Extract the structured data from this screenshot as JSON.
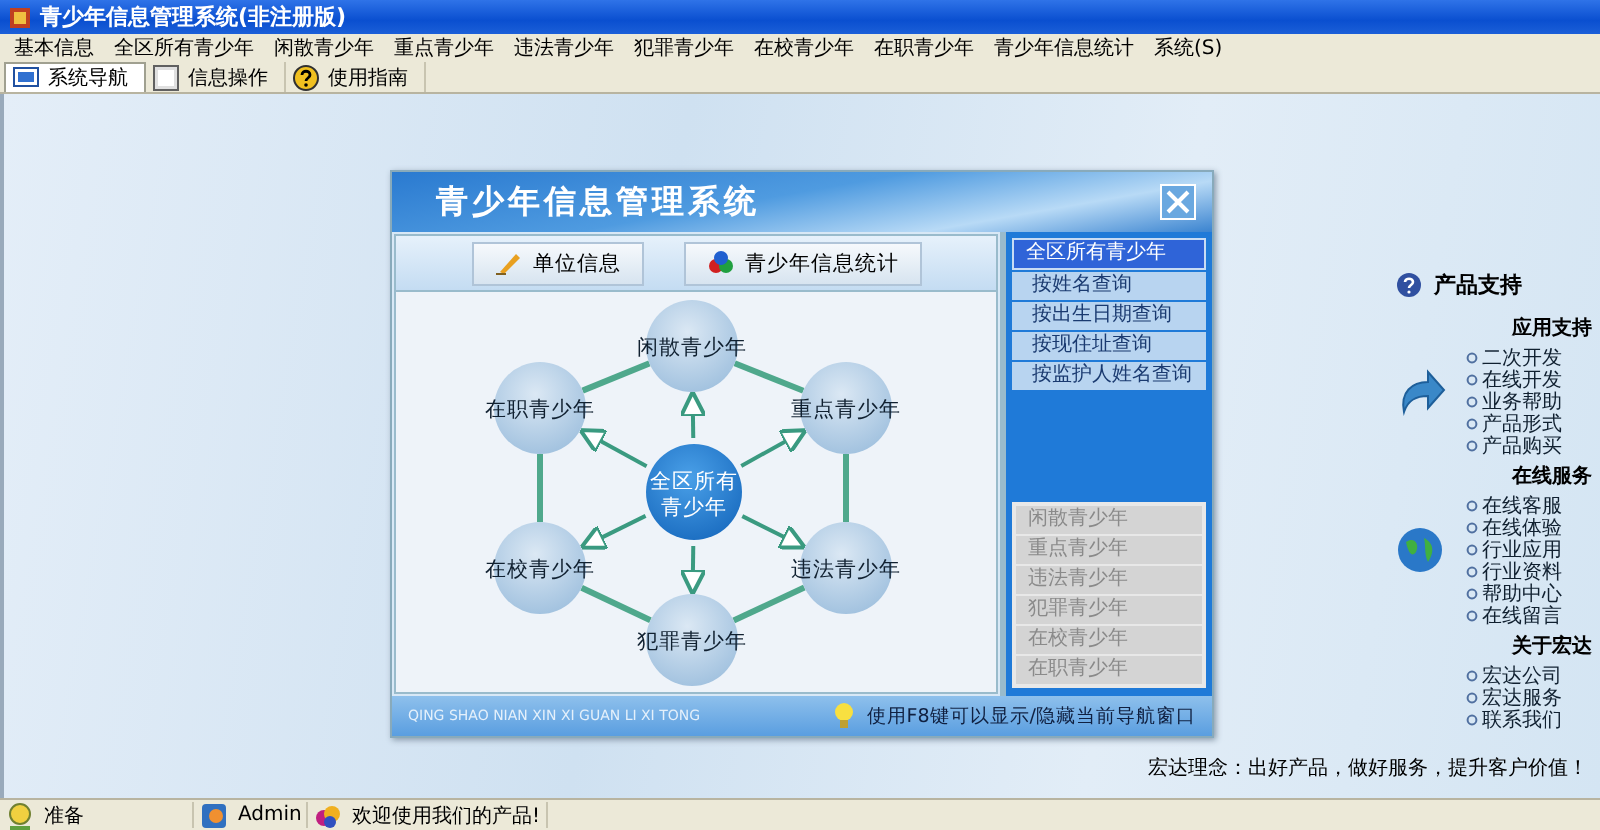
{
  "window": {
    "title": "青少年信息管理系统(非注册版)"
  },
  "menu_bar": [
    "基本信息",
    "全区所有青少年",
    "闲散青少年",
    "重点青少年",
    "违法青少年",
    "犯罪青少年",
    "在校青少年",
    "在职青少年",
    "青少年信息统计",
    "系统(S)"
  ],
  "toolbar_tabs": [
    {
      "label": "系统导航",
      "selected": true
    },
    {
      "label": "信息操作",
      "selected": false
    },
    {
      "label": "使用指南",
      "selected": false
    }
  ],
  "dialog": {
    "title": "青少年信息管理系统",
    "buttons": [
      "单位信息",
      "青少年信息统计"
    ],
    "diagram": {
      "center": "全区所有青少年",
      "nodes": [
        "闲散青少年",
        "重点青少年",
        "违法青少年",
        "犯罪青少年",
        "在校青少年",
        "在职青少年"
      ]
    },
    "query_list": [
      {
        "label": "全区所有青少年",
        "selected": true
      },
      {
        "label": "按姓名查询",
        "selected": false
      },
      {
        "label": "按出生日期查询",
        "selected": false
      },
      {
        "label": "按现住址查询",
        "selected": false
      },
      {
        "label": "按监护人姓名查询",
        "selected": false
      }
    ],
    "category_list": [
      "闲散青少年",
      "重点青少年",
      "违法青少年",
      "犯罪青少年",
      "在校青少年",
      "在职青少年"
    ],
    "footer": {
      "pinyin": "QING SHAO NIAN XIN XI GUAN LI XI TONG",
      "hint": "使用F8键可以显示/隐藏当前导航窗口"
    }
  },
  "support": {
    "title": "产品支持",
    "sections": [
      {
        "heading": "应用支持",
        "links": [
          "二次开发",
          "在线开发",
          "业务帮助",
          "产品形式",
          "产品购买"
        ]
      },
      {
        "heading": "在线服务",
        "links": [
          "在线客服",
          "在线体验",
          "行业应用",
          "行业资料",
          "帮助中心",
          "在线留言"
        ]
      },
      {
        "heading": "关于宏达",
        "links": [
          "宏达公司",
          "宏达服务",
          "联系我们"
        ]
      }
    ],
    "slogan": "宏达理念：出好产品，做好服务，提升客户价值！"
  },
  "status_bar": [
    "准备",
    "Admin",
    "欢迎使用我们的产品!"
  ]
}
